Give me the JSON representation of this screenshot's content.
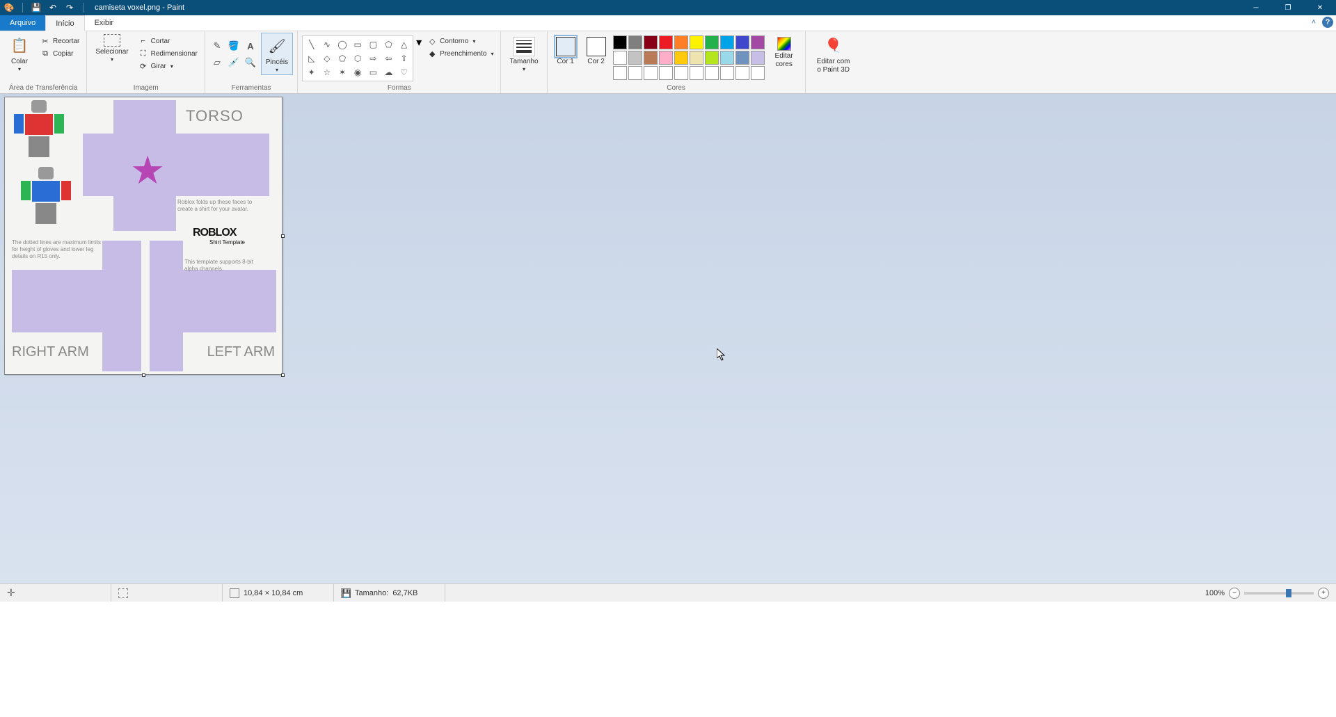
{
  "titlebar": {
    "filename": "camiseta voxel.png",
    "app_name": "Paint",
    "separator": " - "
  },
  "tabs": {
    "file": "Arquivo",
    "home": "Início",
    "view": "Exibir"
  },
  "ribbon": {
    "clipboard": {
      "paste": "Colar",
      "cut": "Recortar",
      "copy": "Copiar",
      "group_label": "Área de Transferência"
    },
    "image": {
      "select": "Selecionar",
      "crop": "Cortar",
      "resize": "Redimensionar",
      "rotate": "Girar",
      "group_label": "Imagem"
    },
    "tools": {
      "brushes": "Pincéis",
      "group_label": "Ferramentas"
    },
    "shapes": {
      "outline": "Contorno",
      "fill": "Preenchimento",
      "group_label": "Formas"
    },
    "sizes": {
      "label": "Tamanho"
    },
    "colors": {
      "color1": "Cor 1",
      "color2": "Cor 2",
      "edit_colors": "Editar cores",
      "group_label": "Cores",
      "color1_value": "#000000",
      "color2_value": "#ffffff",
      "palette_row1": [
        "#000000",
        "#7f7f7f",
        "#880015",
        "#ed1c24",
        "#ff7f27",
        "#fff200",
        "#22b14c",
        "#00a2e8",
        "#3f48cc",
        "#a349a4"
      ],
      "palette_row2": [
        "#ffffff",
        "#c3c3c3",
        "#b97a57",
        "#ffaec9",
        "#ffc90e",
        "#efe4b0",
        "#b5e61d",
        "#99d9ea",
        "#7092be",
        "#c8bfe7"
      ],
      "palette_row3": [
        "#ffffff",
        "#ffffff",
        "#ffffff",
        "#ffffff",
        "#ffffff",
        "#ffffff",
        "#ffffff",
        "#ffffff",
        "#ffffff",
        "#ffffff"
      ]
    },
    "paint3d": {
      "label": "Editar com o Paint 3D"
    }
  },
  "canvas": {
    "torso_label": "TORSO",
    "right_arm_label": "RIGHT ARM",
    "left_arm_label": "LEFT ARM",
    "fold_text": "Roblox folds up these faces to create a shirt for your avatar.",
    "dotted_text": "The dotted lines are maximum limits for height of gloves and lower leg details on R15 only.",
    "alpha_text": "This template supports 8-bit alpha channels.",
    "roblox_logo": "ROBLOX",
    "roblox_sub": "Shirt Template"
  },
  "statusbar": {
    "dimensions": "10,84 × 10,84 cm",
    "size_label": "Tamanho:",
    "size_value": "62,7KB",
    "zoom": "100%"
  }
}
